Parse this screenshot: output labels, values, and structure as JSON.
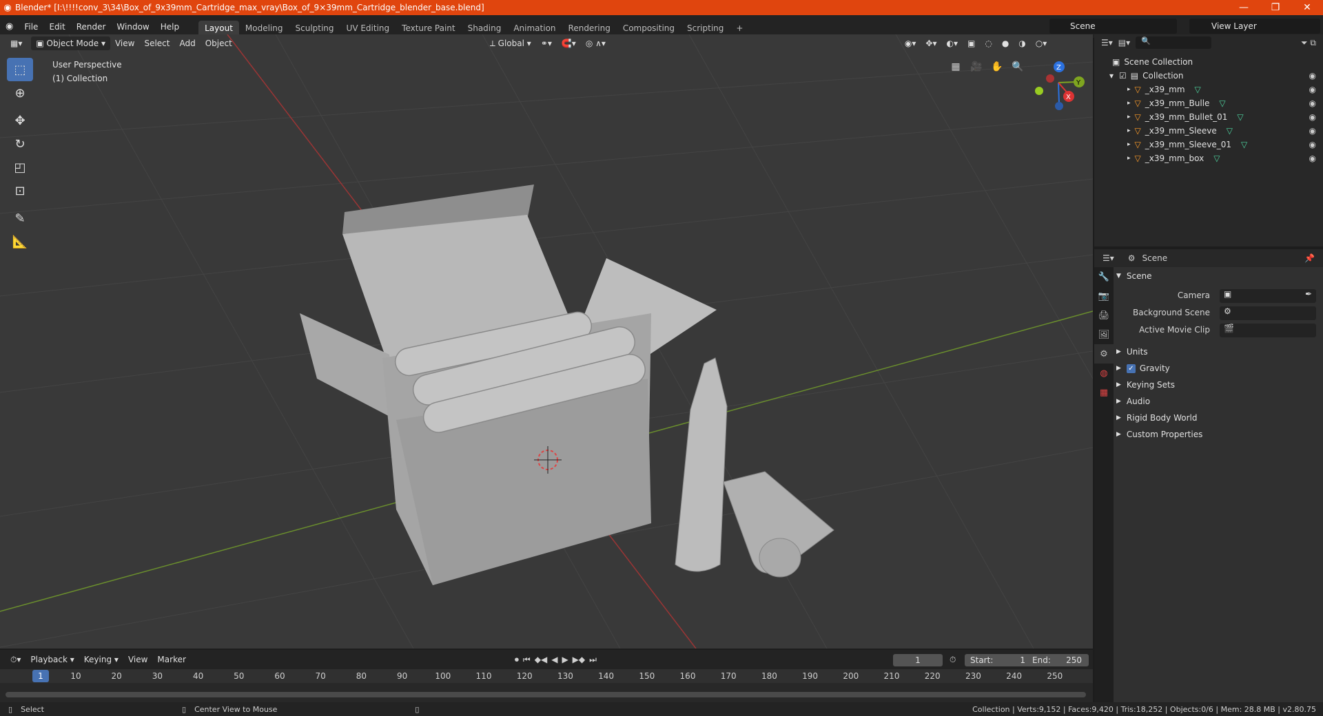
{
  "window": {
    "title": "Blender* [I:\\!!!!conv_3\\34\\Box_of_9x39mm_Cartridge_max_vray\\Box_of_9×39mm_Cartridge_blender_base.blend]"
  },
  "menu": {
    "file": "File",
    "edit": "Edit",
    "render": "Render",
    "window": "Window",
    "help": "Help"
  },
  "workspaces": [
    "Layout",
    "Modeling",
    "Sculpting",
    "UV Editing",
    "Texture Paint",
    "Shading",
    "Animation",
    "Rendering",
    "Compositing",
    "Scripting"
  ],
  "scene_name": "Scene",
  "view_layer": "View Layer",
  "viewport_header": {
    "mode": "Object Mode",
    "view": "View",
    "select": "Select",
    "add": "Add",
    "object": "Object",
    "orientation": "Global"
  },
  "viewport_info": {
    "line1": "User Perspective",
    "line2": "(1) Collection"
  },
  "gizmo": {
    "x": "X",
    "y": "Y",
    "z": "Z"
  },
  "outliner": {
    "root": "Scene Collection",
    "collection": "Collection",
    "items": [
      "_x39_mm",
      "_x39_mm_Bulle",
      "_x39_mm_Bullet_01",
      "_x39_mm_Sleeve",
      "_x39_mm_Sleeve_01",
      "_x39_mm_box"
    ]
  },
  "properties": {
    "header": "Scene",
    "section": "Scene",
    "camera_label": "Camera",
    "bg_scene_label": "Background Scene",
    "movie_clip_label": "Active Movie Clip",
    "panels": [
      "Units",
      "Gravity",
      "Keying Sets",
      "Audio",
      "Rigid Body World",
      "Custom Properties"
    ]
  },
  "timeline": {
    "playback": "Playback",
    "keying": "Keying",
    "view": "View",
    "marker": "Marker",
    "current": "1",
    "start_label": "Start:",
    "start": "1",
    "end_label": "End:",
    "end": "250",
    "ruler": [
      "10",
      "20",
      "30",
      "40",
      "50",
      "60",
      "70",
      "80",
      "90",
      "100",
      "110",
      "120",
      "130",
      "140",
      "150",
      "160",
      "170",
      "180",
      "190",
      "200",
      "210",
      "220",
      "230",
      "240",
      "250"
    ],
    "ruler_current": "1"
  },
  "status": {
    "left": "Select",
    "middle": "Center View to Mouse",
    "right": "Collection | Verts:9,152 | Faces:9,420 | Tris:18,252 | Objects:0/6 | Mem: 28.8 MB | v2.80.75"
  },
  "colors": {
    "title_bar": "#e0450e",
    "accent": "#4772b3",
    "mesh_icon": "#4ed4a0",
    "object_icon": "#ff9d2a"
  }
}
